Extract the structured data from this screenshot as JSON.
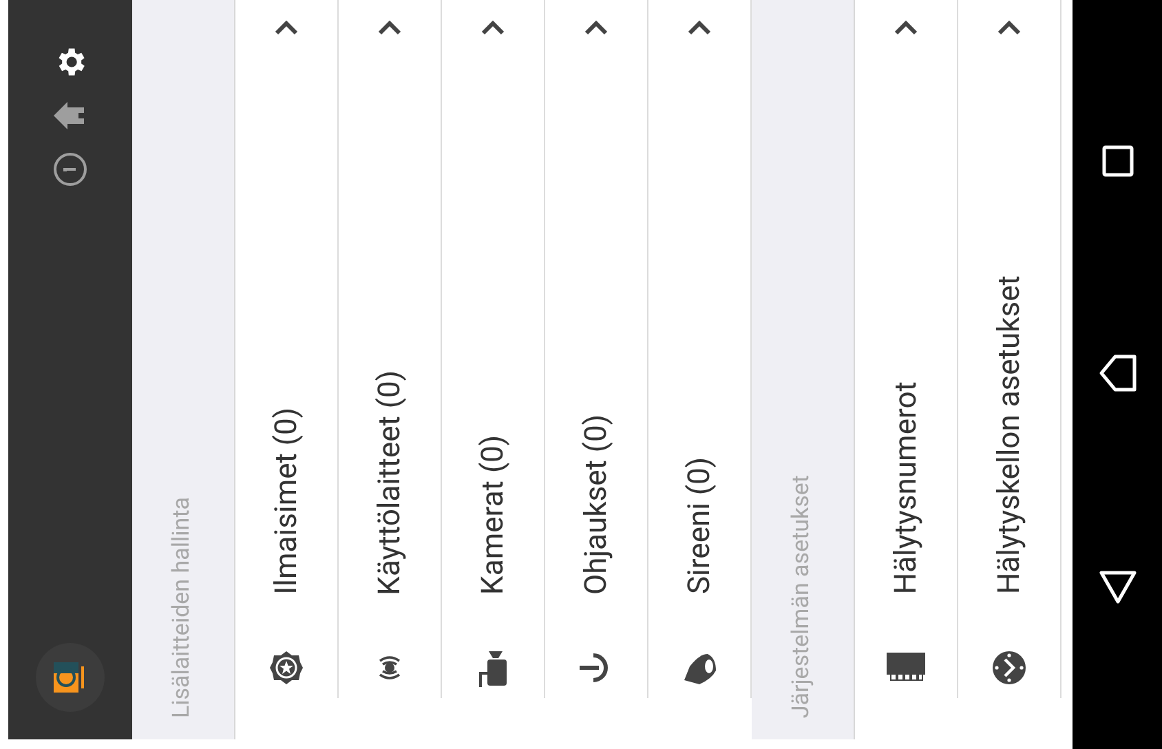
{
  "sections": [
    {
      "title": "Lisälaitteiden hallinta",
      "items": [
        {
          "label": "Ilmaisimet (0)",
          "kind": "detector"
        },
        {
          "label": "Käyttölaitteet (0)",
          "kind": "device"
        },
        {
          "label": "Kamerat (0)",
          "kind": "camera"
        },
        {
          "label": "Ohjaukset (0)",
          "kind": "control"
        },
        {
          "label": "Sireeni (0)",
          "kind": "siren"
        }
      ]
    },
    {
      "title": "Järjestelmän asetukset",
      "items": [
        {
          "label": "Hälytysnumerot",
          "kind": "numbers"
        },
        {
          "label": "Hälytyskellon asetukset",
          "kind": "clock"
        }
      ]
    }
  ]
}
